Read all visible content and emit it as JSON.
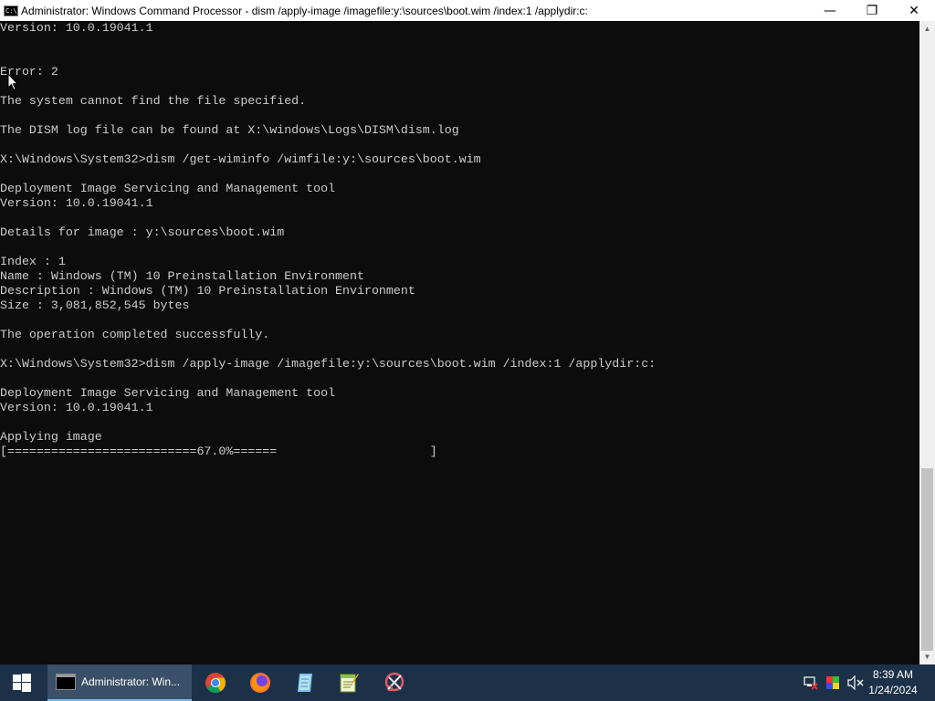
{
  "window": {
    "title": "Administrator: Windows Command Processor - dism  /apply-image /imagefile:y:\\sources\\boot.wim /index:1 /applydir:c:",
    "icon_label": "C:\\",
    "controls": {
      "minimize": "—",
      "maximize": "❐",
      "close": "✕"
    }
  },
  "console": {
    "lines": [
      "Version: 10.0.19041.1",
      "",
      "",
      "Error: 2",
      "",
      "The system cannot find the file specified.",
      "",
      "The DISM log file can be found at X:\\windows\\Logs\\DISM\\dism.log",
      "",
      "X:\\Windows\\System32>dism /get-wiminfo /wimfile:y:\\sources\\boot.wim",
      "",
      "Deployment Image Servicing and Management tool",
      "Version: 10.0.19041.1",
      "",
      "Details for image : y:\\sources\\boot.wim",
      "",
      "Index : 1",
      "Name : Windows (TM) 10 Preinstallation Environment",
      "Description : Windows (TM) 10 Preinstallation Environment",
      "Size : 3,081,852,545 bytes",
      "",
      "The operation completed successfully.",
      "",
      "X:\\Windows\\System32>dism /apply-image /imagefile:y:\\sources\\boot.wim /index:1 /applydir:c:",
      "",
      "Deployment Image Servicing and Management tool",
      "Version: 10.0.19041.1",
      "",
      "Applying image",
      "[==========================67.0%======                     ]"
    ],
    "progress_percent": 67.0
  },
  "taskbar": {
    "active_task_label": "Administrator: Win...",
    "pinned_icons": [
      "chrome-icon",
      "firefox-icon",
      "notepad-icon",
      "notepadplusplus-icon",
      "snipping-tool-icon"
    ],
    "tray_icons": [
      "network-icon",
      "color-picker-icon",
      "volume-muted-icon"
    ],
    "time": "8:39 AM",
    "date": "1/24/2024"
  },
  "colors": {
    "console_bg": "#0c0c0c",
    "console_text": "#cccccc",
    "taskbar_bg": "#1c3148",
    "active_task_bg": "#3a5068"
  }
}
